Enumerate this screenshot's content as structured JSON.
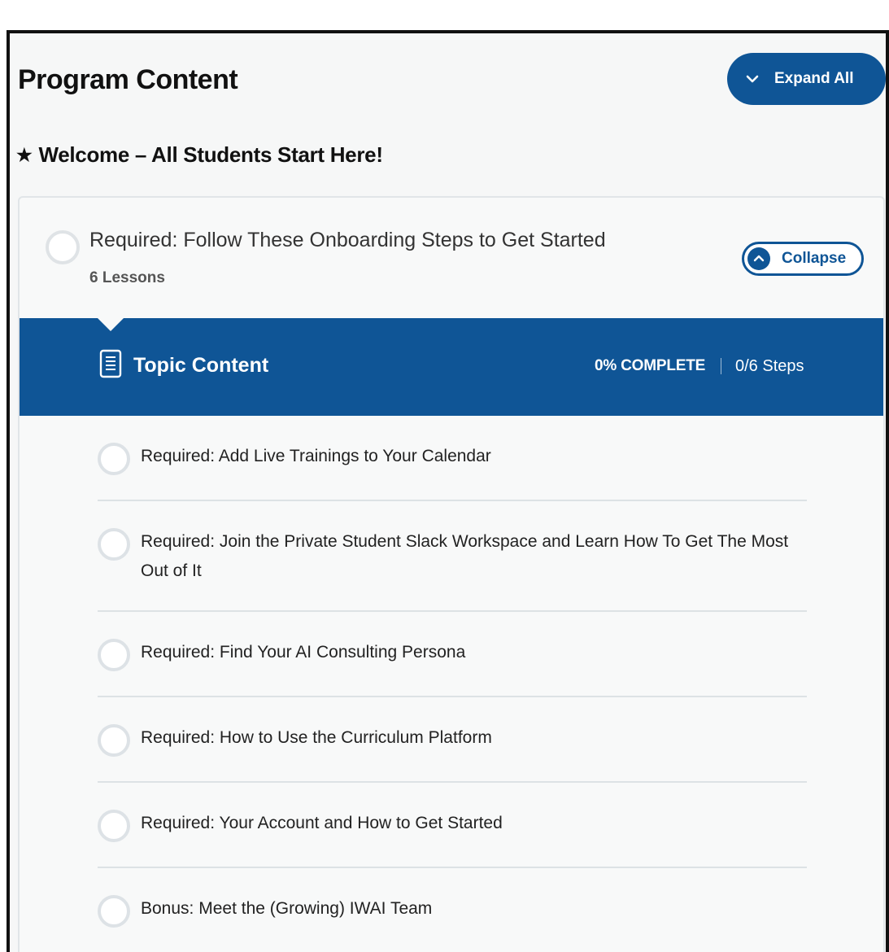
{
  "program": {
    "title": "Program Content",
    "expand_all_label": "Expand All"
  },
  "section": {
    "star": "★",
    "title": "Welcome – All Students Start Here!"
  },
  "lesson": {
    "title": "Required: Follow These Onboarding Steps to Get Started",
    "count": "6 Lessons",
    "collapse_label": "Collapse"
  },
  "topic": {
    "title": "Topic Content",
    "progress": "0% COMPLETE",
    "steps": "0/6 Steps"
  },
  "steps": [
    {
      "label": "Required: Add Live Trainings to Your Calendar"
    },
    {
      "label": "Required: Join the Private Student Slack Workspace and Learn How To Get The Most Out of It"
    },
    {
      "label": "Required: Find Your AI Consulting Persona"
    },
    {
      "label": "Required: How to Use the Curriculum Platform"
    },
    {
      "label": "Required: Your Account and How to Get Started"
    },
    {
      "label": "Bonus: Meet the (Growing) IWAI Team"
    }
  ],
  "colors": {
    "brand_blue": "#0f5596",
    "circle_border": "#dde2e6"
  }
}
